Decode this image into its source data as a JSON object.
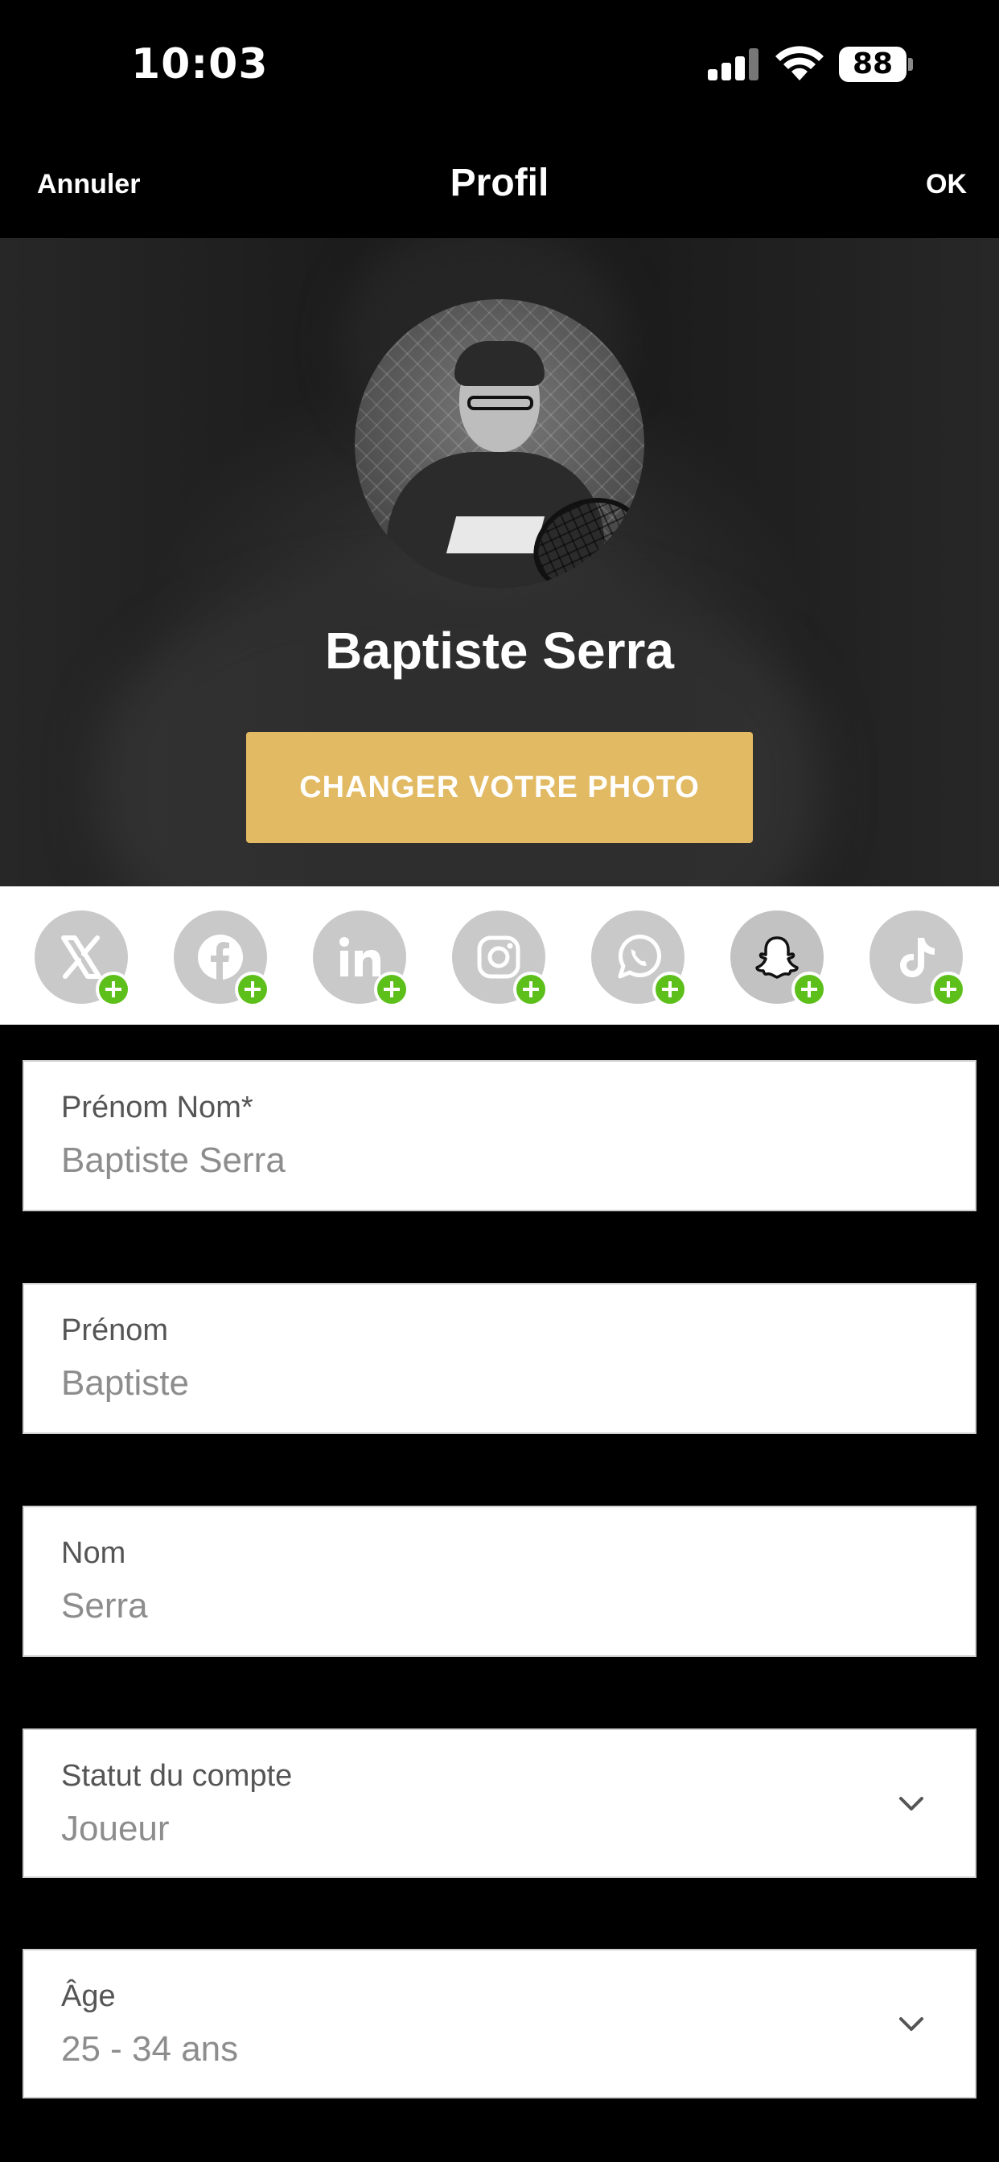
{
  "status_bar": {
    "time": "10:03",
    "battery": "88"
  },
  "nav": {
    "cancel_label": "Annuler",
    "title": "Profil",
    "ok_label": "OK"
  },
  "profile": {
    "name": "Baptiste Serra",
    "change_photo_label": "CHANGER VOTRE PHOTO"
  },
  "socials": [
    {
      "icon": "x-twitter-icon"
    },
    {
      "icon": "facebook-icon"
    },
    {
      "icon": "linkedin-icon"
    },
    {
      "icon": "instagram-icon"
    },
    {
      "icon": "whatsapp-icon"
    },
    {
      "icon": "snapchat-icon"
    },
    {
      "icon": "tiktok-icon"
    }
  ],
  "form": {
    "full_name": {
      "label": "Prénom Nom*",
      "value": "Baptiste Serra"
    },
    "first_name": {
      "label": "Prénom",
      "value": "Baptiste"
    },
    "last_name": {
      "label": "Nom",
      "value": "Serra"
    },
    "account_status": {
      "label": "Statut du compte",
      "value": "Joueur"
    },
    "age": {
      "label": "Âge",
      "value": "25 - 34 ans"
    }
  },
  "colors": {
    "accent_button": "#e2ba63",
    "plus_badge": "#5cbf1a",
    "social_bg": "#c9c9c9"
  }
}
